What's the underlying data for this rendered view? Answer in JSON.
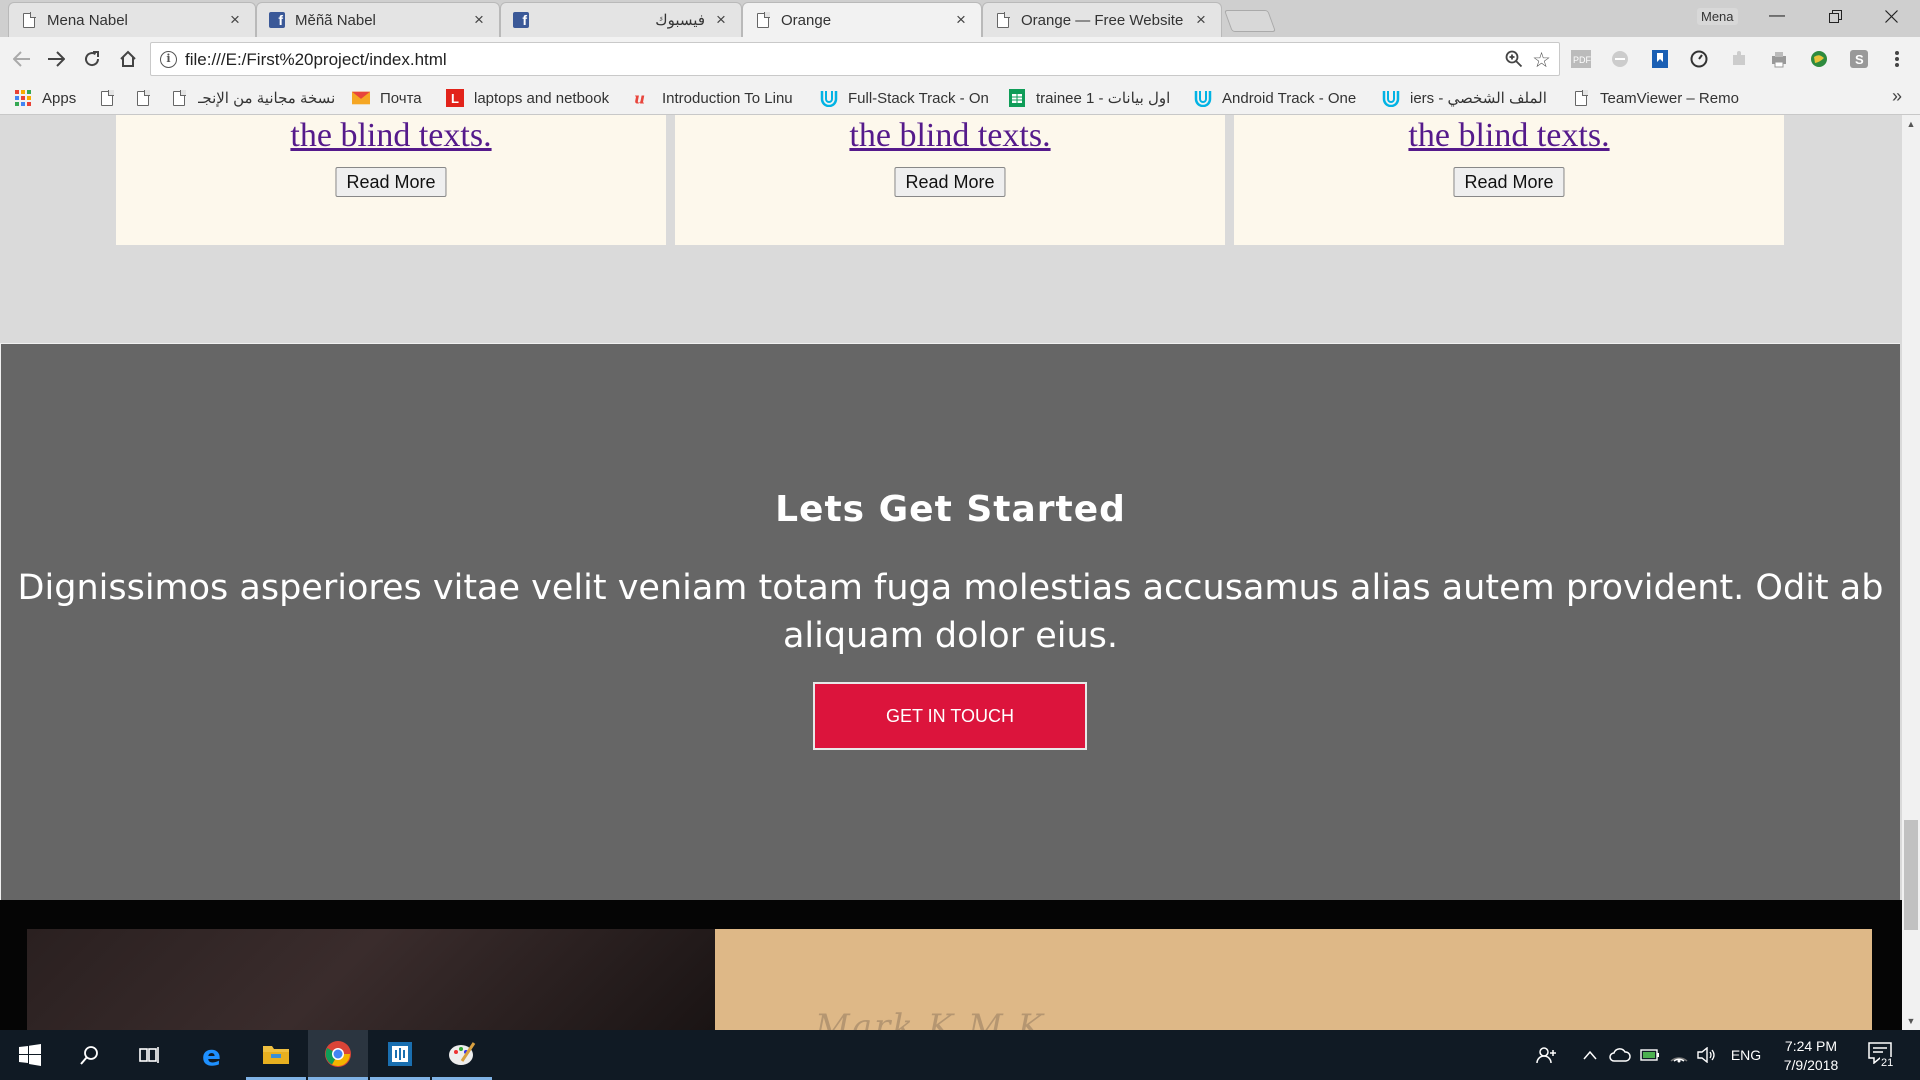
{
  "browser": {
    "tabs": [
      {
        "title": "Mena Nabel",
        "icon": "doc-icon",
        "active": false
      },
      {
        "title": "Měñã Nabel",
        "icon": "facebook-icon",
        "active": false
      },
      {
        "title": "فيسبوك",
        "icon": "facebook-icon",
        "active": false
      },
      {
        "title": "Orange",
        "icon": "doc-icon",
        "active": true
      },
      {
        "title": "Orange — Free Website T",
        "icon": "doc-icon",
        "active": false
      }
    ],
    "user_name": "Mena",
    "url": "file:///E:/First%20project/index.html",
    "bookmarks": [
      {
        "label": "Apps",
        "icon": "apps-grid-icon"
      },
      {
        "label": "",
        "icon": "doc-icon"
      },
      {
        "label": "",
        "icon": "doc-icon"
      },
      {
        "label": "نسخة مجانية من الإنجـ",
        "icon": "doc-icon"
      },
      {
        "label": "Почта",
        "icon": "mail-icon"
      },
      {
        "label": "laptops and netbook",
        "icon": "lenovo-l-icon"
      },
      {
        "label": "Introduction To Linu",
        "icon": "udacity-u-icon"
      },
      {
        "label": "Full-Stack Track - On",
        "icon": "udacity-icon"
      },
      {
        "label": "trainee 1 - اول بيانات",
        "icon": "sheets-icon"
      },
      {
        "label": "Android Track - One",
        "icon": "udacity-icon"
      },
      {
        "label": "الملف الشخصي - iers",
        "icon": "udacity-icon"
      },
      {
        "label": "TeamViewer – Remo",
        "icon": "doc-icon"
      }
    ]
  },
  "page": {
    "cards": [
      {
        "link": "the blind texts.",
        "button": "Read More"
      },
      {
        "link": "the blind texts.",
        "button": "Read More"
      },
      {
        "link": "the blind texts.",
        "button": "Read More"
      }
    ],
    "cta": {
      "title": "Lets Get Started",
      "text": "Dignissimos asperiores vitae velit veniam totam fuga molestias accusamus alias autem provident. Odit ab aliquam dolor eius.",
      "button": "GET IN TOUCH"
    },
    "footer_faded_text": "Mark K.M.K"
  },
  "taskbar": {
    "language": "ENG",
    "time": "7:24 PM",
    "date": "7/9/2018",
    "notification_count": "21"
  },
  "colors": {
    "cta_background": "#666666",
    "cta_button": "#dc143c",
    "card_background": "#fdf8ec",
    "link": "#551a8b",
    "footer_tan": "#deb887"
  }
}
